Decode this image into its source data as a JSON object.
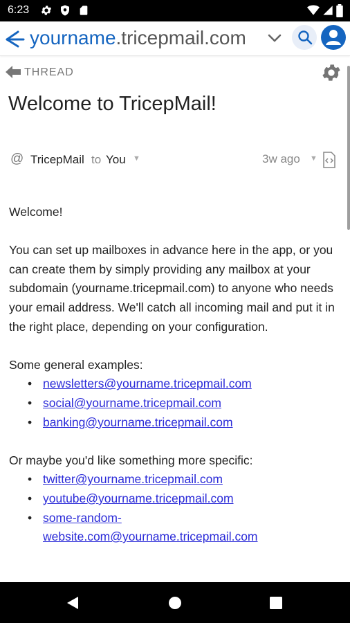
{
  "status_bar": {
    "time": "6:23",
    "icons": [
      "gear-icon",
      "shield-icon",
      "sd-card-icon",
      "wifi-icon",
      "cell-signal-icon",
      "battery-icon"
    ]
  },
  "app_bar": {
    "domain_sub": "yourname",
    "domain_rest": ".tricepmail.com",
    "icons": [
      "app-logo-icon",
      "chevron-down-icon",
      "search-icon",
      "account-icon"
    ],
    "accent_color": "#1565c0"
  },
  "thread": {
    "back_label": "THREAD"
  },
  "message": {
    "subject": "Welcome to TricepMail!",
    "at_symbol": "@",
    "from": "TricepMail",
    "to_word": "to",
    "recipient": "You",
    "time_ago": "3w ago",
    "body": {
      "greeting": "Welcome!",
      "intro": "You can set up mailboxes in advance here in the app, or you can create them by simply providing any mailbox at your subdomain (yourname.tricepmail.com) to anyone who needs your email address. We'll catch all incoming mail and put it in the right place, depending on your configuration.",
      "general_heading": "Some general examples:",
      "general_links": [
        "newsletters@yourname.tricepmail.com",
        "social@yourname.tricepmail.com",
        "banking@yourname.tricepmail.com"
      ],
      "specific_heading": "Or maybe you'd like something more specific:",
      "specific_links": [
        "twitter@yourname.tricepmail.com",
        "youtube@yourname.tricepmail.com",
        "some-random-website.com@yourname.tricepmail.com"
      ]
    }
  },
  "nav_bar": {
    "icons": [
      "back-icon",
      "home-icon",
      "recents-icon"
    ]
  }
}
